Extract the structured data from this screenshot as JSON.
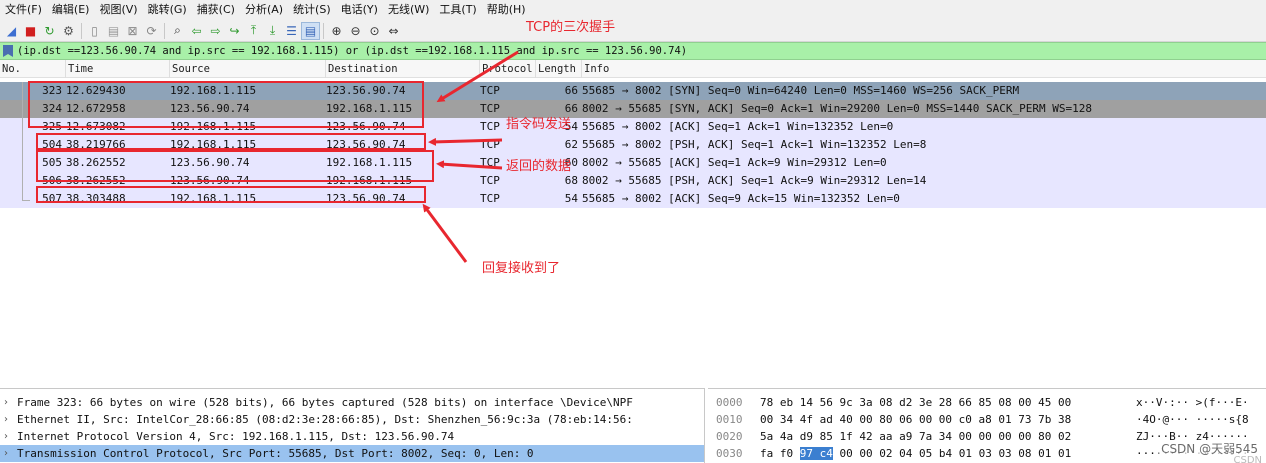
{
  "menu": [
    "文件(F)",
    "编辑(E)",
    "视图(V)",
    "跳转(G)",
    "捕获(C)",
    "分析(A)",
    "统计(S)",
    "电话(Y)",
    "无线(W)",
    "工具(T)",
    "帮助(H)"
  ],
  "toolbar_icons": [
    "shark-fin-icon",
    "stop-icon",
    "restart-icon",
    "options-icon",
    "open-icon",
    "save-icon",
    "close-file-icon",
    "reload-icon",
    "find-icon",
    "back-icon",
    "forward-icon",
    "go-to-packet-icon",
    "first-packet-icon",
    "last-packet-icon",
    "autoscroll-icon",
    "colorize-icon",
    "zoom-in-icon",
    "zoom-out-icon",
    "zoom-reset-icon",
    "resize-columns-icon"
  ],
  "filter": "(ip.dst ==123.56.90.74 and ip.src == 192.168.1.115) or (ip.dst ==192.168.1.115 and ip.src == 123.56.90.74)",
  "columns": {
    "no": "No.",
    "time": "Time",
    "source": "Source",
    "destination": "Destination",
    "protocol": "Protocol",
    "length": "Length",
    "info": "Info"
  },
  "packets": [
    {
      "no": "323",
      "time": "12.629430",
      "source": "192.168.1.115",
      "destination": "123.56.90.74",
      "protocol": "TCP",
      "length": "66",
      "info": "55685 → 8002 [SYN] Seq=0 Win=64240 Len=0 MSS=1460 WS=256 SACK_PERM",
      "bg": "#8ea3b8"
    },
    {
      "no": "324",
      "time": "12.672958",
      "source": "123.56.90.74",
      "destination": "192.168.1.115",
      "protocol": "TCP",
      "length": "66",
      "info": "8002 → 55685 [SYN, ACK] Seq=0 Ack=1 Win=29200 Len=0 MSS=1440 SACK_PERM WS=128",
      "bg": "#a0a0a0"
    },
    {
      "no": "325",
      "time": "12.673082",
      "source": "192.168.1.115",
      "destination": "123.56.90.74",
      "protocol": "TCP",
      "length": "54",
      "info": "55685 → 8002 [ACK] Seq=1 Ack=1 Win=132352 Len=0",
      "bg": "#e7e6ff"
    },
    {
      "no": "504",
      "time": "38.219766",
      "source": "192.168.1.115",
      "destination": "123.56.90.74",
      "protocol": "TCP",
      "length": "62",
      "info": "55685 → 8002 [PSH, ACK] Seq=1 Ack=1 Win=132352 Len=8",
      "bg": "#e7e6ff"
    },
    {
      "no": "505",
      "time": "38.262552",
      "source": "123.56.90.74",
      "destination": "192.168.1.115",
      "protocol": "TCP",
      "length": "60",
      "info": "8002 → 55685 [ACK] Seq=1 Ack=9 Win=29312 Len=0",
      "bg": "#e7e6ff"
    },
    {
      "no": "506",
      "time": "38.262552",
      "source": "123.56.90.74",
      "destination": "192.168.1.115",
      "protocol": "TCP",
      "length": "68",
      "info": "8002 → 55685 [PSH, ACK] Seq=1 Ack=9 Win=29312 Len=14",
      "bg": "#e7e6ff"
    },
    {
      "no": "507",
      "time": "38.303488",
      "source": "192.168.1.115",
      "destination": "123.56.90.74",
      "protocol": "TCP",
      "length": "54",
      "info": "55685 → 8002 [ACK] Seq=9 Ack=15 Win=132352 Len=0",
      "bg": "#e7e6ff"
    }
  ],
  "annotations": {
    "handshake": "TCP的三次握手",
    "command_sent": "指令码发送",
    "returned_data": "返回的数据",
    "reply_received": "回复接收到了",
    "color": "#e8272f"
  },
  "details": [
    {
      "text": "Frame 323: 66 bytes on wire (528 bits), 66 bytes captured (528 bits) on interface \\Device\\NPF",
      "selected": false
    },
    {
      "text": "Ethernet II, Src: IntelCor_28:66:85 (08:d2:3e:28:66:85), Dst: Shenzhen_56:9c:3a (78:eb:14:56:",
      "selected": false
    },
    {
      "text": "Internet Protocol Version 4, Src: 192.168.1.115, Dst: 123.56.90.74",
      "selected": false
    },
    {
      "text": "Transmission Control Protocol, Src Port: 55685, Dst Port: 8002, Seq: 0, Len: 0",
      "selected": true
    }
  ],
  "hex": [
    {
      "offset": "0000",
      "pre": "78 eb 14 56 9c 3a 08 d2  3e 28 66 85 08 00 45 00",
      "hl": "",
      "post": "",
      "ascii": "x··V·:·· >(f···E·"
    },
    {
      "offset": "0010",
      "pre": "00 34 4f ad 40 00 80 06  00 00 c0 a8 01 73 7b 38",
      "hl": "",
      "post": "",
      "ascii": "·4O·@··· ·····s{8"
    },
    {
      "offset": "0020",
      "pre": "5a 4a d9 85 1f 42 aa a9  7a 34 00 00 00 00 80 02",
      "hl": "",
      "post": "",
      "ascii": "ZJ···B·· z4······"
    },
    {
      "offset": "0030",
      "pre": "fa f0 ",
      "hl": "97 c4",
      "post": " 00 00 02 04  05 b4 01 03 03 08 01 01",
      "ascii": "········ ········"
    }
  ],
  "watermark": "CSDN @天弱545",
  "watermark_tail": "CSDN"
}
